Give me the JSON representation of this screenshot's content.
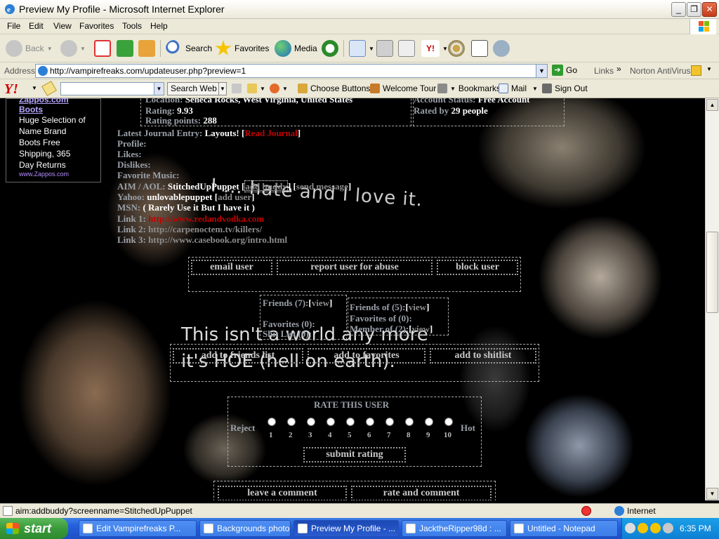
{
  "window": {
    "title": "Preview My Profile - Microsoft Internet Explorer",
    "min": "_",
    "max": "❐",
    "close": "✕"
  },
  "menu": [
    "File",
    "Edit",
    "View",
    "Favorites",
    "Tools",
    "Help"
  ],
  "toolbar": {
    "back": "Back",
    "search": "Search",
    "favorites": "Favorites",
    "media": "Media"
  },
  "address": {
    "label": "Address",
    "url": "http://vampirefreaks.com/updateuser.php?preview=1",
    "go": "Go",
    "links": "Links",
    "norton": "Norton AntiVirus"
  },
  "yahoo": {
    "logo": "Y!",
    "search_web": "Search Web",
    "choose_buttons": "Choose Buttons",
    "welcome_tour": "Welcome Tour",
    "bookmarks": "Bookmarks",
    "mail": "Mail",
    "sign_out": "Sign Out"
  },
  "ad": {
    "title": "Zappos.com Boots",
    "text": "Huge Selection of Name Brand Boots Free Shipping, 365 Day Returns",
    "url": "www.Zappos.com"
  },
  "profile": {
    "location_label": "Location:",
    "location": "Seneca Rocks, West Virginia, United States",
    "rating_label": "Rating:",
    "rating": "9.93",
    "points_label": "Rating points:",
    "points": "288",
    "account_label": "Account Status:",
    "account": "Free Account",
    "rated_by_label": "Rated by",
    "rated_by": "29 people",
    "journal_label": "Latest Journal Entry:",
    "journal": "Layouts!",
    "read_journal": "Read Journal",
    "profile_label": "Profile:",
    "likes_label": "Likes:",
    "dislikes_label": "Dislikes:",
    "music_label": "Favorite Music:",
    "aim_label": "AIM / AOL:",
    "aim": "StitchedUpPuppet",
    "add_buddy": "add buddy",
    "send_message": "send message",
    "yahoo_label": "Yahoo:",
    "yahoo": "unlovablepuppet",
    "add_user": "add user",
    "msn_label": "MSN:",
    "msn": "( Rarely Use it But I have it )",
    "link1_label": "Link 1:",
    "link1": "http://www.redandvodka.com",
    "link2_label": "Link 2:",
    "link2": "http://carpenoctem.tv/killers/",
    "link3_label": "Link 3:",
    "link3": "http://www.casebook.org/intro.html"
  },
  "actions": {
    "email": "email user",
    "report": "report user for abuse",
    "block": "block user"
  },
  "friends": {
    "friends_label": "Friends (7):",
    "view": "view",
    "favorites_label": "Favorites (0):",
    "shit_list": "Shit List (0):",
    "friends_of_label": "Friends of (5):",
    "favorites_of_label": "Favorites of (0):",
    "member_of_label": "Member of (2):"
  },
  "adds": {
    "friends": "add to friends list",
    "favorites": "add to favorites",
    "shitlist": "add to shitlist"
  },
  "rate": {
    "title": "RATE THIS USER",
    "reject": "Reject",
    "hot": "Hot",
    "numbers": [
      "1",
      "2",
      "3",
      "4",
      "5",
      "6",
      "7",
      "8",
      "9",
      "10"
    ],
    "submit": "submit rating"
  },
  "comment": {
    "leave": "leave a comment",
    "rate_and": "rate and comment"
  },
  "taglines": {
    "line1": "I ... hate and I love it.",
    "line2": "This isn't a world any more",
    "line3": "it's HOE (hell on earth)."
  },
  "status": {
    "text": "aim:addbuddy?screenname=StitchedUpPuppet",
    "zone": "Internet"
  },
  "taskbar": {
    "start": "start",
    "tasks": [
      "Edit Vampirefreaks P...",
      "Backgrounds photo ...",
      "Preview My Profile - ...",
      "JacktheRipper98d : ...",
      "Untitled - Notepad"
    ],
    "clock": "6:35 PM"
  }
}
